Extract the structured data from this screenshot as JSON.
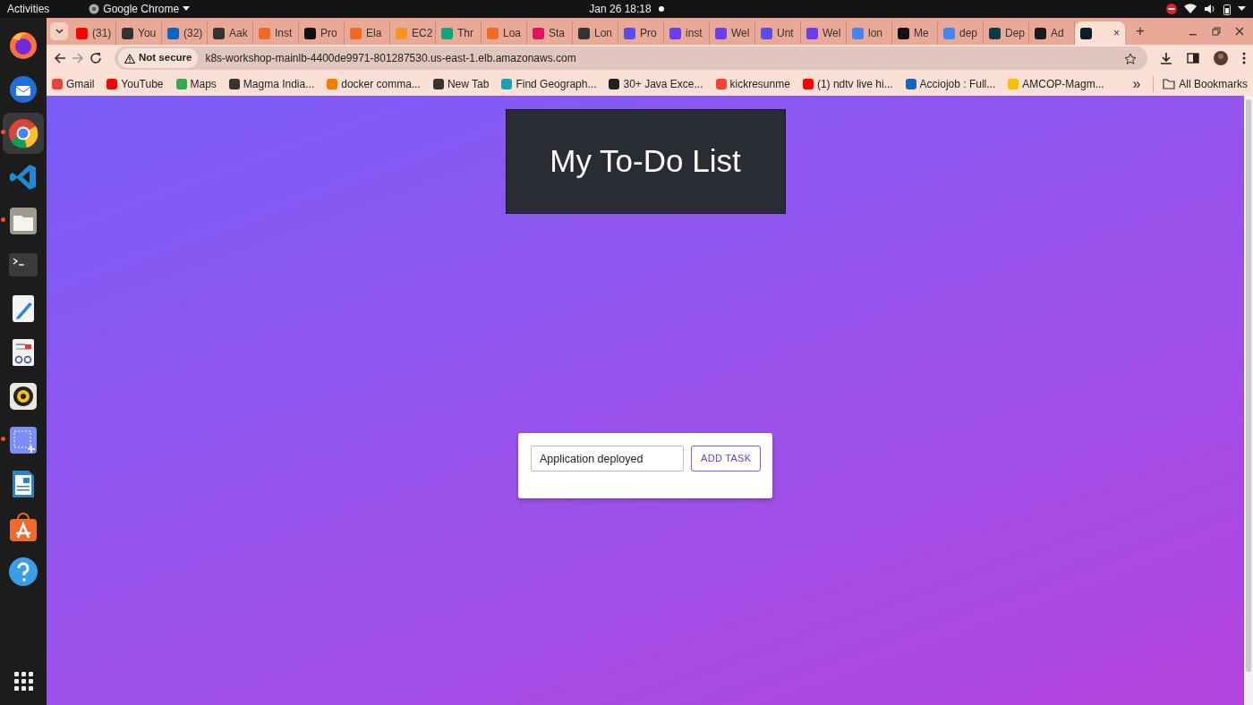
{
  "top_bar": {
    "activities": "Activities",
    "app_name": "Google Chrome",
    "clock": "Jan 26  18:18"
  },
  "dock": {
    "apps": [
      {
        "kind": "firefox",
        "running": false,
        "selected": false
      },
      {
        "kind": "mail",
        "running": false,
        "selected": false
      },
      {
        "kind": "chrome",
        "running": true,
        "selected": true
      },
      {
        "kind": "code",
        "running": false,
        "selected": false
      },
      {
        "kind": "files",
        "running": true,
        "selected": false
      },
      {
        "kind": "terminal",
        "running": false,
        "selected": false
      },
      {
        "kind": "editor",
        "running": false,
        "selected": false
      },
      {
        "kind": "viewer",
        "running": false,
        "selected": false
      },
      {
        "kind": "music",
        "running": false,
        "selected": false
      },
      {
        "kind": "screenshot",
        "running": true,
        "selected": false
      },
      {
        "kind": "writer",
        "running": false,
        "selected": false
      },
      {
        "kind": "store",
        "running": false,
        "selected": false
      },
      {
        "kind": "help",
        "running": false,
        "selected": false
      }
    ]
  },
  "browser": {
    "tabs": [
      {
        "title": "(31)",
        "color": "#ff0000",
        "selected": false
      },
      {
        "title": "You",
        "color": "#333333",
        "selected": false
      },
      {
        "title": "(32)",
        "color": "#0a66c2",
        "selected": false
      },
      {
        "title": "Aak",
        "color": "#333333",
        "selected": false
      },
      {
        "title": "Inst",
        "color": "#f16a22",
        "selected": false
      },
      {
        "title": "Pro",
        "color": "#111111",
        "selected": false
      },
      {
        "title": "Ela",
        "color": "#f16a22",
        "selected": false
      },
      {
        "title": "EC2",
        "color": "#f7931e",
        "selected": false
      },
      {
        "title": "Thr",
        "color": "#10a37f",
        "selected": false
      },
      {
        "title": "Loa",
        "color": "#f16a22",
        "selected": false
      },
      {
        "title": "Sta",
        "color": "#e0115f",
        "selected": false
      },
      {
        "title": "Lon",
        "color": "#333333",
        "selected": false
      },
      {
        "title": "Pro",
        "color": "#5b4ee8",
        "selected": false
      },
      {
        "title": "inst",
        "color": "#6a3cf0",
        "selected": false
      },
      {
        "title": "Wel",
        "color": "#6a3cf0",
        "selected": false
      },
      {
        "title": "Unt",
        "color": "#5b4ee8",
        "selected": false
      },
      {
        "title": "Wel",
        "color": "#6a3cf0",
        "selected": false
      },
      {
        "title": "lon",
        "color": "#4285f4",
        "selected": false
      },
      {
        "title": "Me",
        "color": "#111111",
        "selected": false
      },
      {
        "title": "dep",
        "color": "#4285f4",
        "selected": false
      },
      {
        "title": "Dep",
        "color": "#0e3b43",
        "selected": false
      },
      {
        "title": "Ad",
        "color": "#1a1a1a",
        "selected": false
      },
      {
        "close": "×",
        "color": "#0b1d2a",
        "selected": true
      }
    ],
    "new_tab": "+",
    "security": "Not secure",
    "url": "k8s-workshop-mainlb-4400de9971-801287530.us-east-1.elb.amazonaws.com",
    "bookmarks": [
      {
        "label": "Gmail",
        "color": "#ea4335"
      },
      {
        "label": "YouTube",
        "color": "#ff0000"
      },
      {
        "label": "Maps",
        "color": "#34a853"
      },
      {
        "label": "Magma India...",
        "color": "#333333"
      },
      {
        "label": "docker comma...",
        "color": "#f57c00"
      },
      {
        "label": "New Tab",
        "color": "#333333"
      },
      {
        "label": "Find Geograph...",
        "color": "#1aa0b3"
      },
      {
        "label": "30+ Java Exce...",
        "color": "#222222"
      },
      {
        "label": "kickresunme",
        "color": "#f44336"
      },
      {
        "label": "(1) ndtv live hi...",
        "color": "#ff0000"
      },
      {
        "label": "Acciojob : Full...",
        "color": "#1565c0"
      },
      {
        "label": "AMCOP-Magm...",
        "color": "#fbbc04"
      }
    ],
    "bookmarks_more": "»",
    "all_bookmarks": "All Bookmarks"
  },
  "page": {
    "title": "My To-Do List",
    "input_value": "Application deployed",
    "button": "ADD TASK"
  }
}
